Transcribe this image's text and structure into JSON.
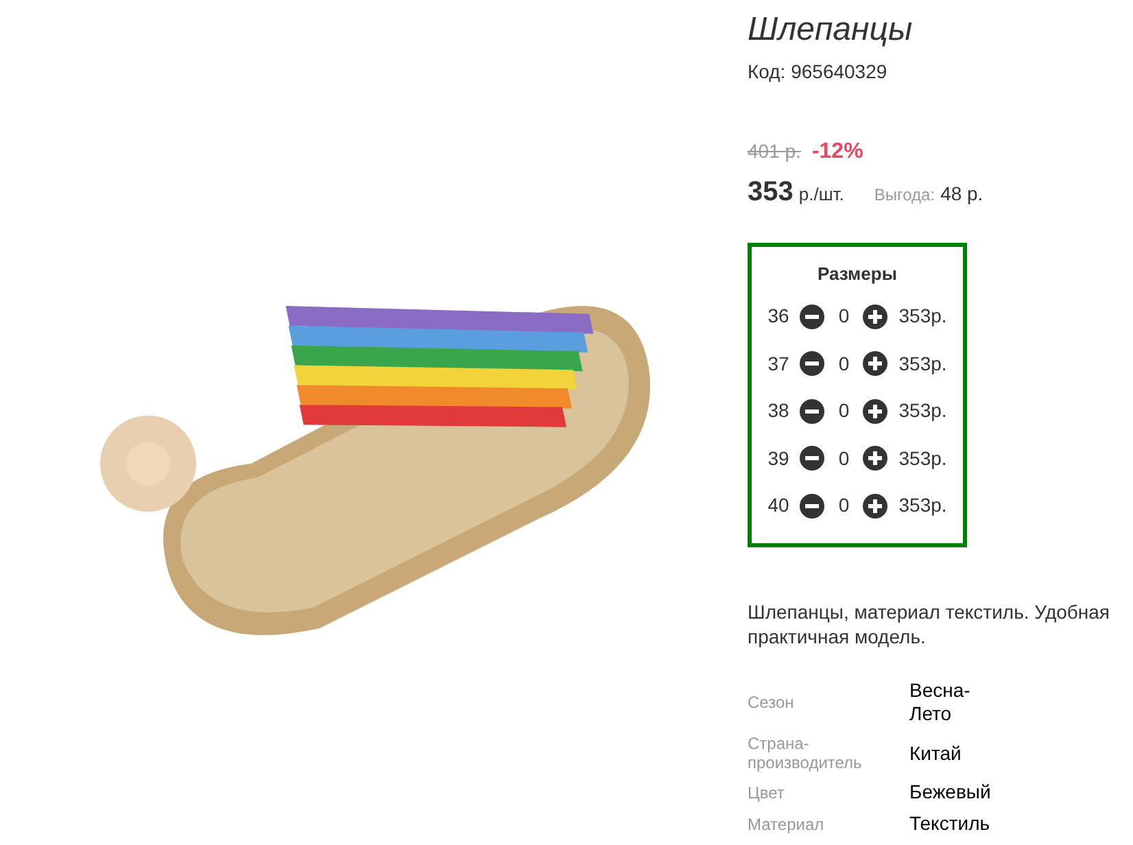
{
  "product": {
    "title": "Шлепанцы",
    "code": "Код: 965640329"
  },
  "price": {
    "old": "401 р.",
    "discount": "-12%",
    "current": "353",
    "unit": "р./шт.",
    "savings_label": "Выгода:",
    "savings": "48 р."
  },
  "sizes": {
    "title": "Размеры",
    "rows": [
      {
        "size": "36",
        "qty": "0",
        "price": "353р."
      },
      {
        "size": "37",
        "qty": "0",
        "price": "353р."
      },
      {
        "size": "38",
        "qty": "0",
        "price": "353р."
      },
      {
        "size": "39",
        "qty": "0",
        "price": "353р."
      },
      {
        "size": "40",
        "qty": "0",
        "price": "353р."
      }
    ]
  },
  "description": "Шлепанцы, материал текстиль. Удобная практичная модель.",
  "specs": [
    {
      "label": "Сезон",
      "value": "Весна-Лето"
    },
    {
      "label": "Страна-производитель",
      "value": "Китай"
    },
    {
      "label": "Цвет",
      "value": "Бежевый"
    },
    {
      "label": "Материал",
      "value": "Текстиль"
    }
  ]
}
